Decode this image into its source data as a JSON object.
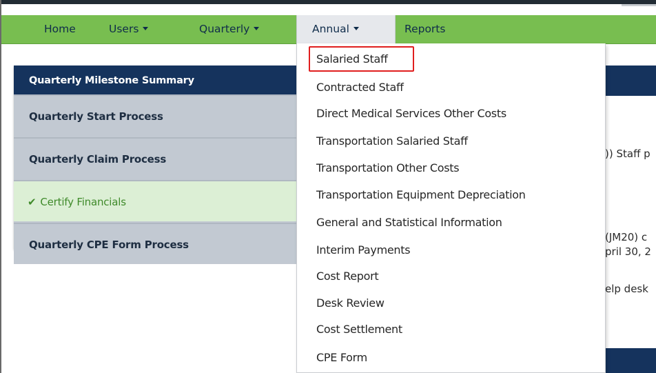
{
  "navbar": {
    "items": [
      {
        "label": "Home"
      },
      {
        "label": "Users"
      },
      {
        "label": "Quarterly"
      },
      {
        "label": "Annual"
      },
      {
        "label": "Reports"
      }
    ]
  },
  "panel": {
    "title": "Quarterly Milestone Summary",
    "rows": [
      {
        "label": "Quarterly Start Process"
      },
      {
        "label": "Quarterly Claim Process"
      },
      {
        "label": "Certify Financials",
        "status": "complete"
      },
      {
        "label": "Quarterly CPE Form Process"
      }
    ]
  },
  "annual_menu": {
    "items": [
      {
        "label": "Salaried Staff",
        "highlighted": true
      },
      {
        "label": "Contracted Staff"
      },
      {
        "label": "Direct Medical Services Other Costs"
      },
      {
        "label": "Transportation Salaried Staff"
      },
      {
        "label": "Transportation Other Costs"
      },
      {
        "label": "Transportation Equipment Depreciation"
      },
      {
        "label": "General and Statistical Information"
      },
      {
        "label": "Interim Payments"
      },
      {
        "label": "Cost Report"
      },
      {
        "label": "Desk Review"
      },
      {
        "label": "Cost Settlement"
      },
      {
        "label": "CPE Form"
      }
    ]
  },
  "background_text": {
    "line1": ")) Staff p",
    "line2": "(JM20) c",
    "line3": "pril 30, 2",
    "line4": "elp desk"
  },
  "colors": {
    "navbar": "#78be50",
    "panel_header": "#15335d",
    "highlight": "#e01e1e",
    "success": "#3f8a2a"
  },
  "icons": {
    "caret": "caret-down-icon",
    "check": "checkmark-icon"
  }
}
